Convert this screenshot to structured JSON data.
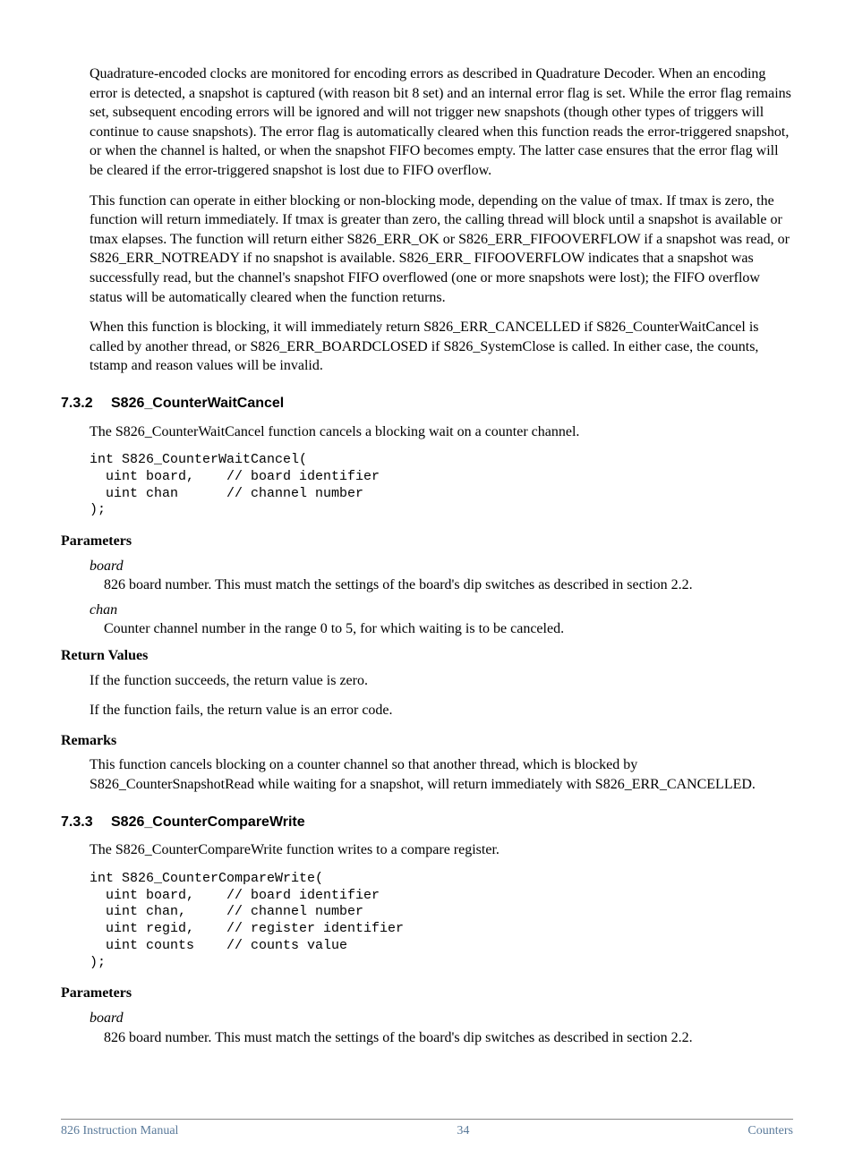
{
  "paragraphs": {
    "intro1": "Quadrature-encoded clocks are monitored for encoding errors as described in Quadrature Decoder. When an encoding error is detected, a snapshot is captured (with reason bit 8 set) and an internal error flag is set. While the error flag remains set, subsequent encoding errors will be ignored and will not trigger new snapshots (though other types of triggers will continue to cause snapshots). The error flag is automatically cleared when this function reads the error-triggered snapshot, or when the channel is halted, or when the snapshot FIFO becomes empty. The latter case ensures that the error flag will be cleared if the error-triggered snapshot is lost due to FIFO overflow.",
    "intro2": "This function can operate in either blocking or non-blocking mode, depending on the value of tmax. If tmax is zero, the function will return immediately. If tmax is greater than zero, the calling thread will block until a snapshot is available or tmax elapses. The function will return either S826_ERR_OK or S826_ERR_FIFOOVERFLOW if a snapshot was read, or S826_ERR_NOTREADY if no snapshot is available. S826_ERR_ FIFOOVERFLOW indicates that a snapshot was successfully read, but the channel's snapshot FIFO overflowed (one or more snapshots were lost); the FIFO overflow status will be automatically cleared when the function returns.",
    "intro3": "When this function is blocking, it will immediately return S826_ERR_CANCELLED if S826_CounterWaitCancel is called by another thread, or S826_ERR_BOARDCLOSED if S826_SystemClose is called. In either case, the counts, tstamp and reason values will be invalid."
  },
  "section732": {
    "number": "7.3.2",
    "title": "S826_CounterWaitCancel",
    "desc": "The S826_CounterWaitCancel function cancels a blocking wait on a counter channel.",
    "code": "int S826_CounterWaitCancel(\n  uint board,    // board identifier\n  uint chan      // channel number\n);",
    "params_label": "Parameters",
    "params": {
      "board": {
        "name": "board",
        "desc": "826 board number. This must match the settings of the board's dip switches as described in section 2.2."
      },
      "chan": {
        "name": "chan",
        "desc": "Counter channel number in the range 0 to 5, for which waiting is to be canceled."
      }
    },
    "return_label": "Return Values",
    "return1": "If the function succeeds, the return value is zero.",
    "return2": "If the function fails, the return value is an error code.",
    "remarks_label": "Remarks",
    "remarks": "This function cancels blocking on a counter channel so that another thread, which is blocked by S826_CounterSnapshotRead while waiting for a snapshot, will return immediately with S826_ERR_CANCELLED."
  },
  "section733": {
    "number": "7.3.3",
    "title": "S826_CounterCompareWrite",
    "desc": "The S826_CounterCompareWrite function writes to a compare register.",
    "code": "int S826_CounterCompareWrite(\n  uint board,    // board identifier\n  uint chan,     // channel number\n  uint regid,    // register identifier\n  uint counts    // counts value\n);",
    "params_label": "Parameters",
    "params": {
      "board": {
        "name": "board",
        "desc": "826 board number. This must match the settings of the board's dip switches as described in section 2.2."
      }
    }
  },
  "footer": {
    "left": "826 Instruction Manual",
    "center": "34",
    "right": "Counters"
  }
}
